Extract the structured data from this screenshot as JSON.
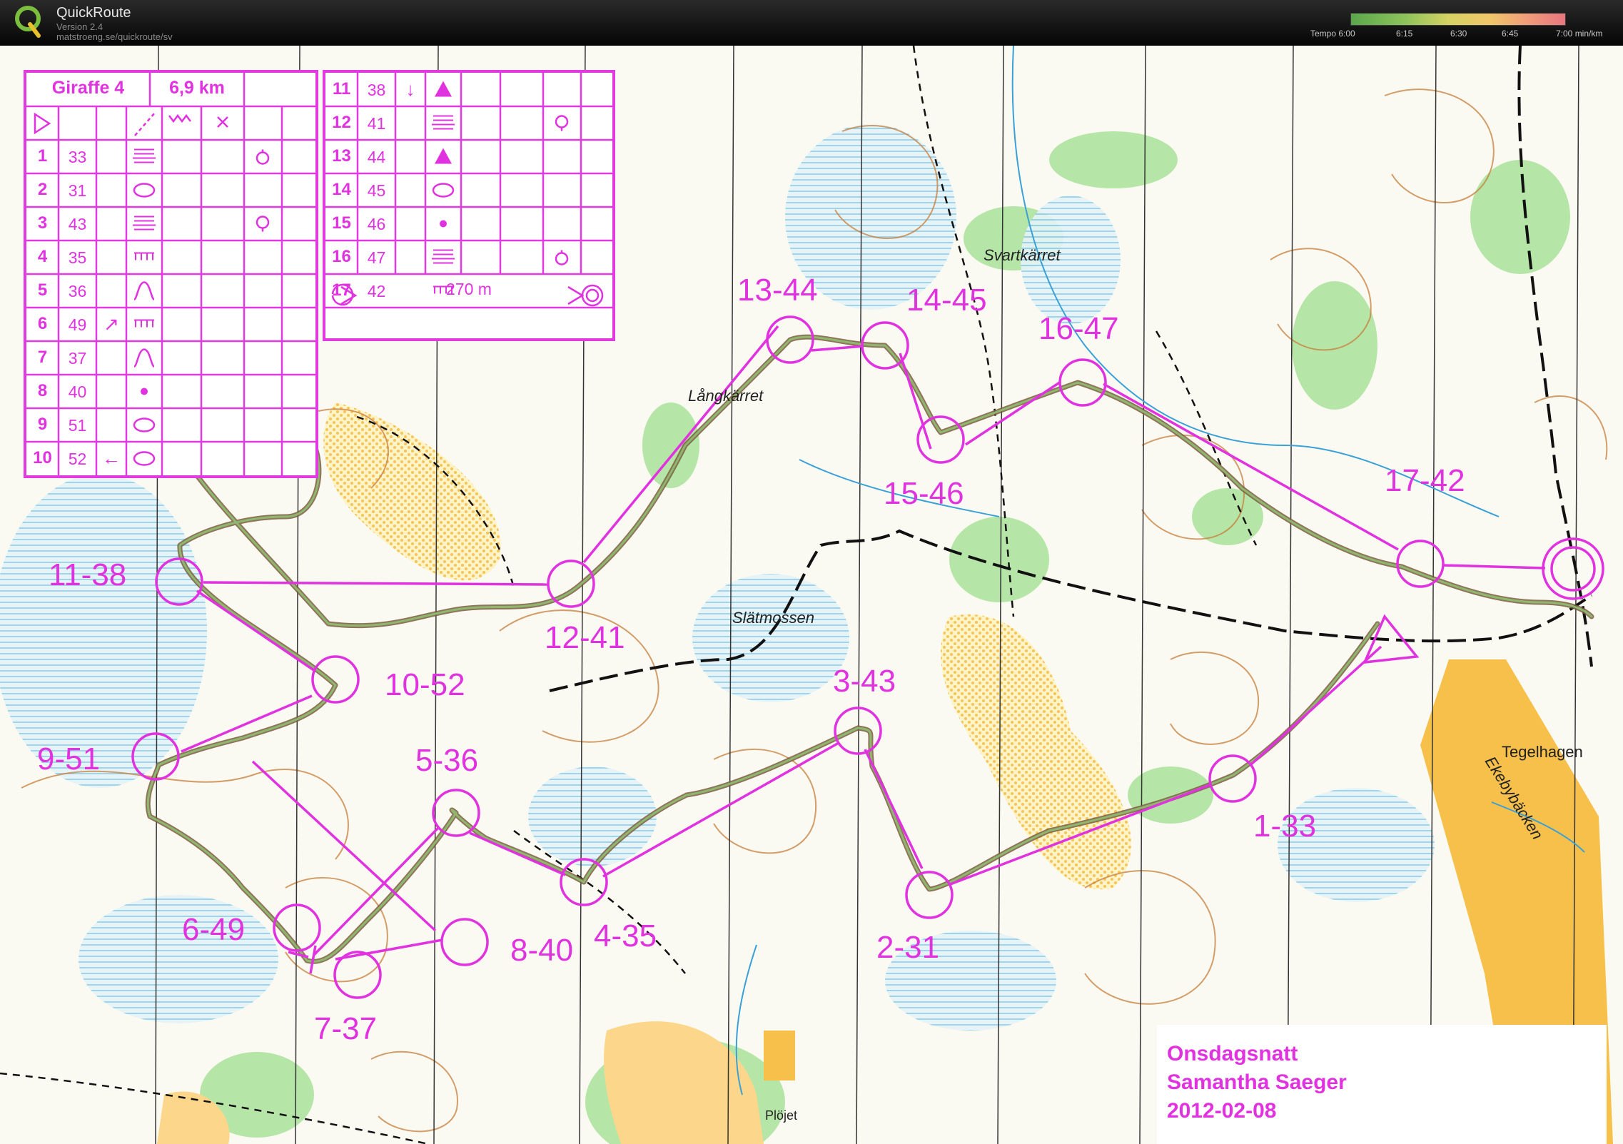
{
  "app": {
    "name": "QuickRoute",
    "version": "Version 2.4",
    "url": "matstroeng.se/quickroute/sv"
  },
  "tempo_legend": {
    "labels": [
      "Tempo 6:00",
      "6:15",
      "6:30",
      "6:45",
      "7:00  min/km"
    ]
  },
  "colors": {
    "course_magenta": "#e132e0",
    "route": "#4f7f4a"
  },
  "description": {
    "course_name": "Giraffe 4",
    "length": "6,9 km",
    "marked_route": "270 m",
    "controls": [
      {
        "num": "1",
        "code": "33",
        "dir": "",
        "feature": "terrace-icon",
        "detail": "knoll-icon"
      },
      {
        "num": "2",
        "code": "31",
        "dir": "",
        "feature": "oval-icon",
        "detail": ""
      },
      {
        "num": "3",
        "code": "43",
        "dir": "",
        "feature": "terrace-icon",
        "detail": "small-knoll-icon"
      },
      {
        "num": "4",
        "code": "35",
        "dir": "",
        "feature": "cliff-comb-icon",
        "detail": ""
      },
      {
        "num": "5",
        "code": "36",
        "dir": "",
        "feature": "hill-shape-icon",
        "detail": ""
      },
      {
        "num": "6",
        "code": "49",
        "dir": "↗",
        "feature": "cliff-comb-icon",
        "detail": ""
      },
      {
        "num": "7",
        "code": "37",
        "dir": "",
        "feature": "hill-shape-icon",
        "detail": ""
      },
      {
        "num": "8",
        "code": "40",
        "dir": "",
        "feature": "dot-icon",
        "detail": ""
      },
      {
        "num": "9",
        "code": "51",
        "dir": "",
        "feature": "oval-icon",
        "detail": ""
      },
      {
        "num": "10",
        "code": "52",
        "dir": "←",
        "feature": "oval-icon",
        "detail": ""
      },
      {
        "num": "11",
        "code": "38",
        "dir": "↓",
        "feature": "triangle-icon",
        "detail": ""
      },
      {
        "num": "12",
        "code": "41",
        "dir": "",
        "feature": "terrace-icon",
        "detail": "small-knoll-icon"
      },
      {
        "num": "13",
        "code": "44",
        "dir": "",
        "feature": "triangle-icon",
        "detail": ""
      },
      {
        "num": "14",
        "code": "45",
        "dir": "",
        "feature": "oval-icon",
        "detail": ""
      },
      {
        "num": "15",
        "code": "46",
        "dir": "",
        "feature": "dot-icon",
        "detail": ""
      },
      {
        "num": "16",
        "code": "47",
        "dir": "",
        "feature": "terrace-icon",
        "detail": "knoll-icon"
      },
      {
        "num": "17",
        "code": "42",
        "dir": "",
        "feature": "cliff-comb-icon",
        "detail": ""
      }
    ]
  },
  "map_labels": {
    "control_labels": [
      "1-33",
      "2-31",
      "3-43",
      "4-35",
      "5-36",
      "6-49",
      "7-37",
      "8-40",
      "9-51",
      "10-52",
      "11-38",
      "12-41",
      "13-44",
      "14-45",
      "15-46",
      "16-47",
      "17-42"
    ],
    "place_names": [
      "Svartkärret",
      "Långkärret",
      "Slätmossen",
      "Tegelhagen",
      "Ekebybäcken",
      "Plöjet"
    ]
  },
  "signature": {
    "event": "Onsdagsnatt",
    "runner": "Samantha Saeger",
    "date": "2012-02-08"
  }
}
